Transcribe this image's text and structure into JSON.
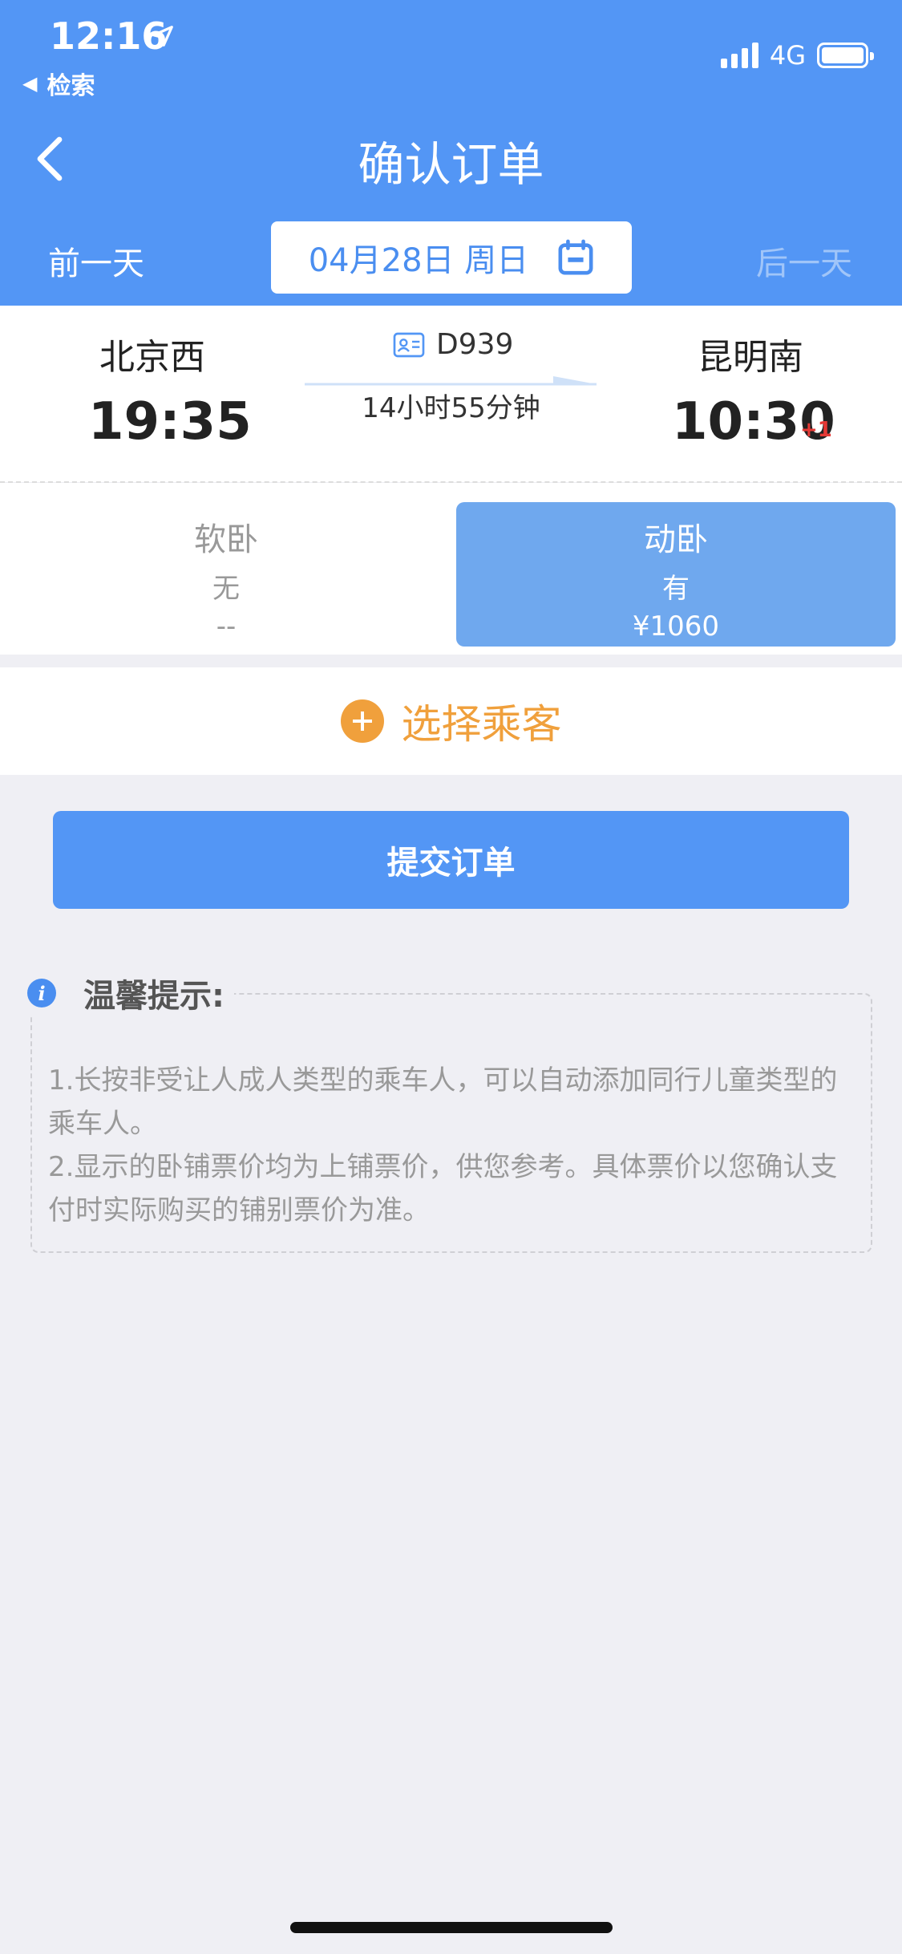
{
  "status_bar": {
    "time": "12:16",
    "back_app": "检索",
    "network": "4G"
  },
  "nav": {
    "title": "确认订单"
  },
  "date_bar": {
    "prev": "前一天",
    "date": "04月28日 周日",
    "next": "后一天"
  },
  "train": {
    "from_station": "北京西",
    "depart_time": "19:35",
    "to_station": "昆明南",
    "arrive_time": "10:30",
    "plus_day": "+1",
    "number": "D939",
    "duration": "14小时55分钟"
  },
  "seats": [
    {
      "name": "软卧",
      "availability": "无",
      "price": "--"
    },
    {
      "name": "动卧",
      "availability": "有",
      "price": "¥1060"
    }
  ],
  "passenger": {
    "label": "选择乘客"
  },
  "submit": {
    "label": "提交订单"
  },
  "tips": {
    "title": "温馨提示:",
    "lines": [
      "1.长按非受让人成人类型的乘车人，可以自动添加同行儿童类型的乘车人。",
      "2.显示的卧铺票价均为上铺票价，供您参考。具体票价以您确认支付时实际购买的铺别票价为准。"
    ]
  },
  "colors": {
    "primary": "#5396f5",
    "accent": "#f0a03c",
    "selected_seat": "#6fa8ee",
    "plus_day": "#e53935"
  },
  "icons": [
    "location-arrow-icon",
    "signal-icon",
    "battery-icon",
    "back-chevron-icon",
    "calendar-icon",
    "id-card-icon",
    "plus-circle-icon",
    "info-icon"
  ]
}
